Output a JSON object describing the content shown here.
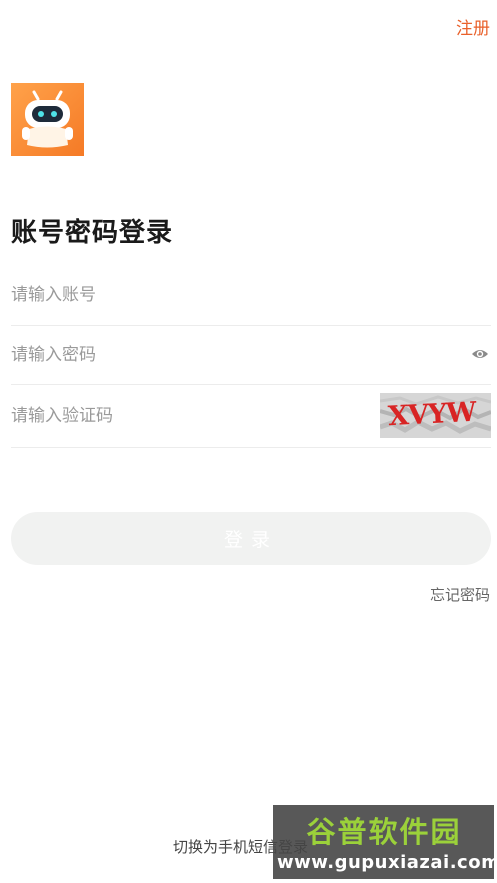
{
  "header": {
    "register_label": "注册"
  },
  "title": "账号密码登录",
  "form": {
    "account_placeholder": "请输入账号",
    "account_value": "",
    "password_placeholder": "请输入密码",
    "password_value": "",
    "captcha_placeholder": "请输入验证码",
    "captcha_value": "",
    "captcha_image_text": "XVYW"
  },
  "actions": {
    "login_label": "登录",
    "forgot_password_label": "忘记密码",
    "switch_login_label": "切换为手机短信登录"
  },
  "icons": {
    "logo": "robot-logo-icon",
    "password_toggle": "eye-icon"
  },
  "colors": {
    "accent": "#e9612b",
    "logo_orange": "#f57a26",
    "login_button_bg": "#f1f2f1"
  },
  "watermark": {
    "title": "谷普软件园",
    "url": "www.gupuxiazai.com"
  }
}
